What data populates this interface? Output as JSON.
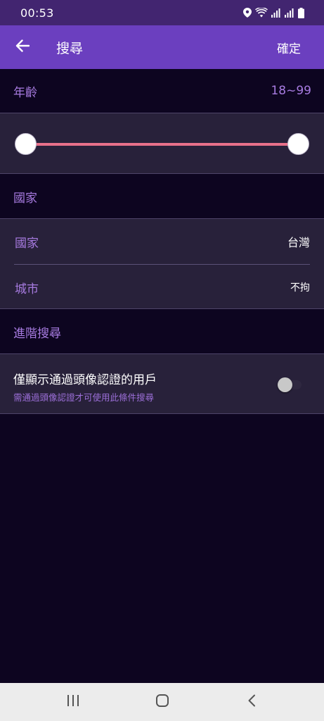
{
  "status_bar": {
    "time": "00:53",
    "icons": [
      "location-icon",
      "wifi-icon",
      "signal-icon",
      "signal-icon-2",
      "battery-icon"
    ]
  },
  "app_bar": {
    "back_icon": "arrow-left-icon",
    "title": "搜尋",
    "confirm_label": "確定"
  },
  "age_section": {
    "label": "年齡",
    "range_text": "18~99",
    "min_value": 18,
    "max_value": 99,
    "slider_min_position": 0,
    "slider_max_position": 1,
    "track_color": "#e8708a"
  },
  "country_section": {
    "header": "國家",
    "rows": [
      {
        "label": "國家",
        "value": "台灣"
      },
      {
        "label": "城市",
        "value": "不拘"
      }
    ]
  },
  "advanced_section": {
    "header": "進階搜尋",
    "verified_only": {
      "title": "僅顯示通過頭像認證的用戶",
      "subtitle": "需通過頭像認證才可使用此條件搜尋",
      "enabled": false
    }
  },
  "nav_bar": {
    "icons": [
      "recent-apps-icon",
      "home-icon",
      "back-nav-icon"
    ]
  },
  "colors": {
    "background": "#0d0520",
    "app_bar": "#6b3fbf",
    "status_bar": "#422570",
    "accent_text": "#a77be0",
    "panel": "#28213a"
  }
}
